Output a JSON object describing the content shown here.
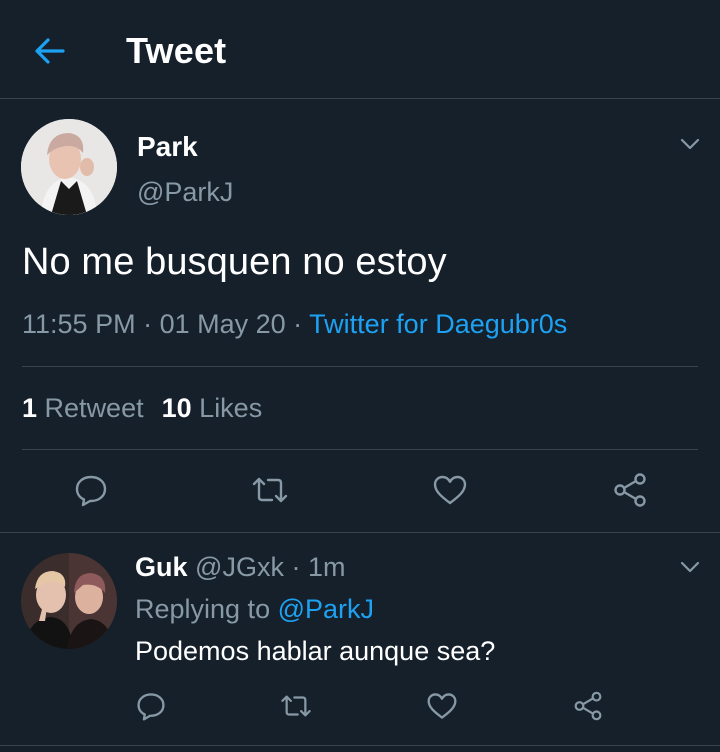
{
  "header": {
    "title": "Tweet",
    "back_icon": "arrow-left-icon"
  },
  "colors": {
    "background": "#15202b",
    "accent": "#1da1f2",
    "muted": "#8899a6",
    "divider": "#38444d"
  },
  "tweet": {
    "name": "Park",
    "handle": "@ParkJ",
    "text": "No me busquen no estoy",
    "time": "11:55 PM",
    "sep1": " · ",
    "date": "01 May 20",
    "sep2": " · ",
    "source": "Twitter for Daegubr0s",
    "retweets_count": "1",
    "retweets_label": "Retweet",
    "likes_count": "10",
    "likes_label": "Likes",
    "actions": [
      "reply-icon",
      "retweet-icon",
      "like-icon",
      "share-icon"
    ]
  },
  "reply": {
    "name": "Guk",
    "handle": "@JGxk",
    "sep": " · ",
    "time": "1m",
    "replying_label": "Replying to ",
    "replying_to": "@ParkJ",
    "text": "Podemos hablar aunque sea?",
    "actions": [
      "reply-icon",
      "retweet-icon",
      "like-icon",
      "share-icon"
    ]
  }
}
